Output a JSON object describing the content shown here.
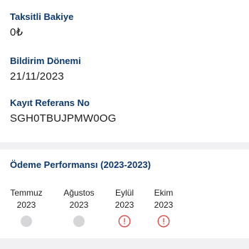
{
  "fields": [
    {
      "label": "Taksitli Bakiye",
      "value": "0₺"
    },
    {
      "label": "Bildirim Dönemi",
      "value": "21/11/2023"
    },
    {
      "label": "Kayıt Referans No",
      "value": "SGH0TBUJPMW0OG"
    }
  ],
  "performance": {
    "title": "Ödeme Performansı (2023-2023)",
    "months": [
      {
        "name": "Temmuz",
        "year": "2023",
        "status": "none"
      },
      {
        "name": "Ağustos",
        "year": "2023",
        "status": "none"
      },
      {
        "name": "Eylül",
        "year": "2023",
        "status": "late",
        "icon": "alert-circle-icon"
      },
      {
        "name": "Ekim",
        "year": "2023",
        "status": "late",
        "icon": "alert-circle-icon"
      }
    ]
  },
  "colors": {
    "label": "#0e3a6e",
    "late": "#d9453f",
    "neutral_dot": "#d6d6d8"
  }
}
